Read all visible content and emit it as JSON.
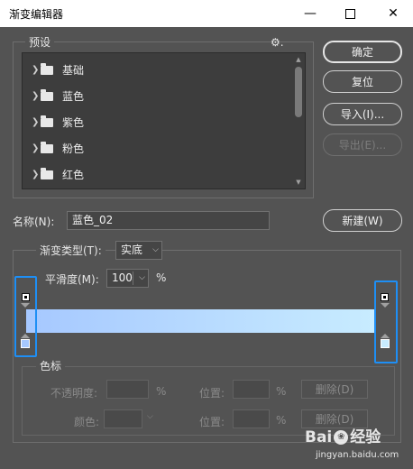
{
  "window": {
    "title": "渐变编辑器",
    "min_glyph": "—",
    "close_glyph": "✕"
  },
  "presets": {
    "legend": "预设",
    "gear_glyph": "⚙.",
    "items": [
      {
        "label": "基础"
      },
      {
        "label": "蓝色"
      },
      {
        "label": "紫色"
      },
      {
        "label": "粉色"
      },
      {
        "label": "红色"
      }
    ],
    "chevron": "❯"
  },
  "buttons": {
    "ok": "确定",
    "reset": "复位",
    "import": "导入(I)...",
    "export": "导出(E)...",
    "new": "新建(W)"
  },
  "name": {
    "label": "名称(N):",
    "value": "蓝色_02"
  },
  "gradient": {
    "type_label": "渐变类型(T):",
    "type_value": "实底",
    "smooth_label": "平滑度(M):",
    "smooth_value": "100",
    "smooth_unit": "%",
    "colors": [
      "#a6c8ff",
      "#c8ecff"
    ]
  },
  "color_stops": {
    "legend": "色标",
    "opacity_label": "不透明度:",
    "opacity_unit": "%",
    "position_label": "位置:",
    "position_unit": "%",
    "delete_label": "删除(D)",
    "color_label": "颜色:"
  },
  "watermark": {
    "brand_left": "Bai",
    "brand_right": "经验",
    "url": "jingyan.baidu.com"
  }
}
